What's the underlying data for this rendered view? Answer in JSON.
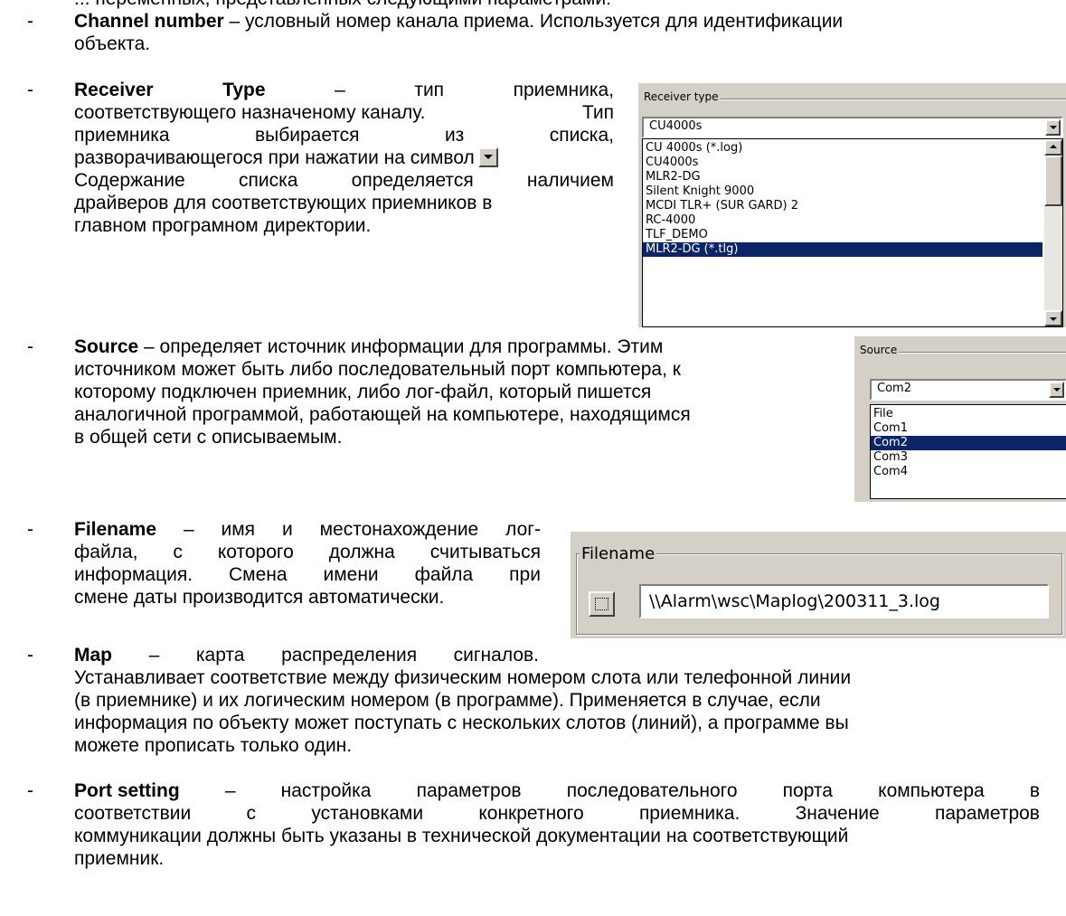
{
  "header": {
    "line": "... переменных, представленных следующими параметрами:"
  },
  "channel": {
    "term": "Channel number",
    "desc1": " – условный номер канала приема. Используется для идентификации",
    "desc2": "объекта."
  },
  "receiver": {
    "term": "Receiver",
    "term2": "Type",
    "lines": [
      [
        "–",
        "тип",
        "приемника,"
      ],
      [
        "соответствующего назначеному каналу.",
        "Тип"
      ],
      [
        "приемника",
        "выбирается",
        "из",
        "списка,"
      ],
      [
        "разворачивающегося при нажатии на символ"
      ],
      [
        "Содержание",
        "списка",
        "определяется",
        "наличием"
      ],
      [
        "драйверов для соответствующих приемников в"
      ],
      [
        "главном програмном директории."
      ]
    ],
    "widget": {
      "group_label": "Receiver type",
      "selected": "CU4000s",
      "items": [
        "CU 4000s (*.log)",
        "CU4000s",
        "MLR2-DG",
        "Silent Knight 9000",
        "MCDI TLR+ (SUR GARD) 2",
        "RC-4000",
        "TLF_DEMO",
        "MLR2-DG (*.tlg)"
      ],
      "highlighted": "MLR2-DG (*.tlg)"
    }
  },
  "source": {
    "term": "Source",
    "lines": [
      " – определяет источник информации для программы. Этим",
      "источником может быть либо последовательный порт компьютера, к",
      "которому подключен приемник, либо лог-файл, который пишется",
      "аналогичной программой, работающей на компьютере, находящимся",
      "в общей сети с описываемым."
    ],
    "widget": {
      "group_label": "Source",
      "selected": "Com2",
      "items": [
        "File",
        "Com1",
        "Com2",
        "Com3",
        "Com4"
      ],
      "highlighted": "Com2"
    }
  },
  "filename": {
    "term": "Filename",
    "lines": [
      [
        "–",
        "имя",
        "и",
        "местонахождение",
        "лог-"
      ],
      [
        "файла,",
        "с",
        "которого",
        "должна",
        "считываться"
      ],
      [
        "информация.",
        "Смена",
        "имени",
        "файла",
        "при"
      ],
      [
        "смене даты производится автоматически."
      ]
    ],
    "widget": {
      "group_label": "Filename",
      "path": "\\\\Alarm\\wsc\\Maplog\\200311_3.log"
    }
  },
  "map": {
    "term": "Map",
    "first": [
      "–",
      "карта",
      "распределения",
      "сигналов."
    ],
    "lines": [
      "Устанавливает соответствие между физическим номером слота или телефонной линии",
      "(в приемнике) и их логическим номером (в программе). Применяется в случае, если",
      "информация по объекту может поступать с нескольких слотов (линий), а программе вы",
      "можете прописать только один."
    ]
  },
  "port": {
    "term": "Port setting",
    "first": [
      "–",
      "настройка",
      "параметров",
      "последовательного",
      "порта",
      "компьютера",
      "в"
    ],
    "line2": [
      "соответствии",
      "с",
      "установками",
      "конкретного",
      "приемника.",
      "Значение",
      "параметров"
    ],
    "line3": "коммуникации должны быть указаны в технической документации на соответствующий",
    "line4": "приемник."
  },
  "bullet": "-"
}
